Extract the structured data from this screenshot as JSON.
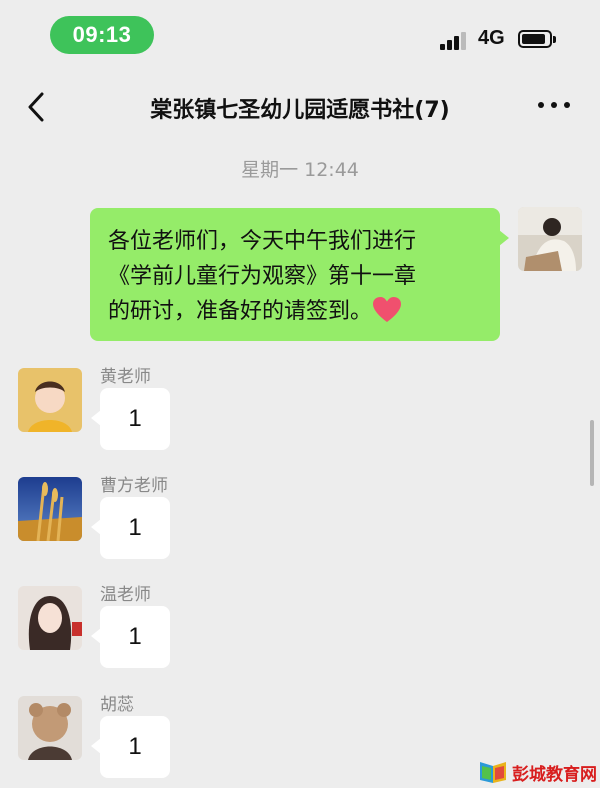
{
  "status_bar": {
    "time": "09:13",
    "network": "4G",
    "icons": [
      "signal-icon",
      "battery-icon"
    ]
  },
  "nav": {
    "title": "棠张镇七圣幼儿园适愿书社(7)",
    "icons": [
      "back-icon",
      "more-icon"
    ]
  },
  "chat": {
    "timestamp": "星期一 12:44",
    "self_message": {
      "lines": [
        "各位老师们，今天中午我们进行",
        "《学前儿童行为观察》第十一章",
        "的研讨，准备好的请签到。"
      ],
      "emoji": "heart-emoji"
    },
    "members": [
      {
        "name": "黄老师",
        "message": "1"
      },
      {
        "name": "曹方老师",
        "message": "1"
      },
      {
        "name": "温老师",
        "message": "1"
      },
      {
        "name": "胡蕊",
        "message": "1"
      }
    ]
  },
  "watermark": {
    "text": "彭城教育网"
  },
  "colors": {
    "time_pill": "#3ec35a",
    "self_bubble": "#95ec69",
    "background": "#ededed",
    "heart": "#f0506e",
    "watermark": "#d81e1e"
  }
}
